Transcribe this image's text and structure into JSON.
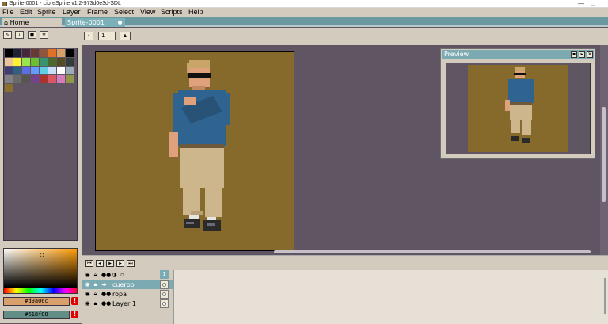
{
  "window": {
    "title": "Sprite-0001 - LibreSprite v1.2-973d0e3d-SDL",
    "minimize": "—",
    "maximize": "□"
  },
  "menu": [
    "File",
    "Edit",
    "Sprite",
    "Layer",
    "Frame",
    "Select",
    "View",
    "Scripts",
    "Help"
  ],
  "tabs": {
    "home": "Home",
    "sprite": "Sprite-0001"
  },
  "palette": [
    "#000000",
    "#222034",
    "#45283c",
    "#663931",
    "#8f563b",
    "#df7126",
    "#d9a066",
    "#000000",
    "#eec39a",
    "#fbf236",
    "#99e550",
    "#6abe30",
    "#37946e",
    "#4b692f",
    "#524b24",
    "#323c39",
    "#3f3f74",
    "#306082",
    "#5b6ee1",
    "#639bff",
    "#5fcde4",
    "#cbdbfc",
    "#ffffff",
    "#9badb7",
    "#847e87",
    "#696a6a",
    "#595652",
    "#76428a",
    "#ac3232",
    "#d95763",
    "#d77bba",
    "#8f974a",
    "#8a6f30"
  ],
  "colors": {
    "foreground": "#d9a06c",
    "background": "#618f88"
  },
  "context": {
    "brush_size": "1"
  },
  "preview": {
    "title": "Preview"
  },
  "layers": [
    {
      "name": "cuerpo",
      "selected": true
    },
    {
      "name": "ropa",
      "selected": false
    },
    {
      "name": "Layer 1",
      "selected": false
    }
  ],
  "timeline": {
    "frame": "1"
  }
}
